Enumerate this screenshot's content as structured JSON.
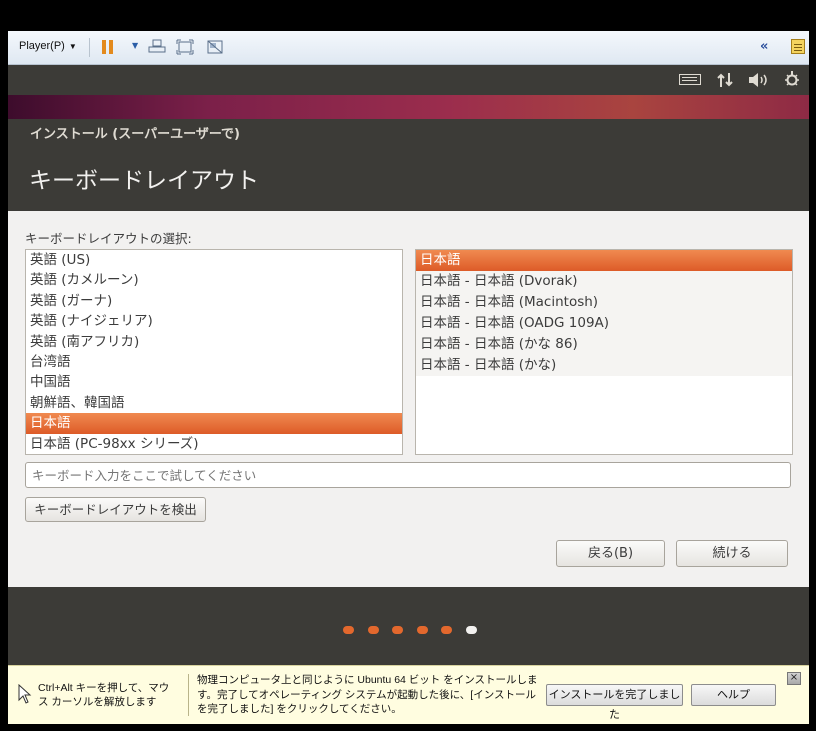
{
  "player": {
    "menu_label": "Player(P)",
    "caret": "▼",
    "pause_caret": "▼",
    "collapse": "«"
  },
  "panel": {
    "icons": [
      "keyboard-icon",
      "network-icon",
      "volume-icon",
      "settings-icon"
    ]
  },
  "window": {
    "title": "インストール (スーパーユーザーで)",
    "page_title": "キーボードレイアウト"
  },
  "layout": {
    "select_label": "キーボードレイアウトの選択:",
    "languages": [
      {
        "label": "英語 (US)",
        "selected": false
      },
      {
        "label": "英語 (カメルーン)",
        "selected": false
      },
      {
        "label": "英語 (ガーナ)",
        "selected": false
      },
      {
        "label": "英語 (ナイジェリア)",
        "selected": false
      },
      {
        "label": "英語 (南アフリカ)",
        "selected": false
      },
      {
        "label": "台湾語",
        "selected": false
      },
      {
        "label": "中国語",
        "selected": false
      },
      {
        "label": "朝鮮語、韓国語",
        "selected": false
      },
      {
        "label": "日本語",
        "selected": true
      },
      {
        "label": "日本語 (PC-98xx シリーズ)",
        "selected": false
      }
    ],
    "variants": [
      {
        "label": "日本語",
        "selected": true
      },
      {
        "label": "日本語 - 日本語 (Dvorak)",
        "selected": false
      },
      {
        "label": "日本語 - 日本語 (Macintosh)",
        "selected": false
      },
      {
        "label": "日本語 - 日本語 (OADG 109A)",
        "selected": false
      },
      {
        "label": "日本語 - 日本語 (かな 86)",
        "selected": false
      },
      {
        "label": "日本語 - 日本語 (かな)",
        "selected": false
      }
    ],
    "try_placeholder": "キーボード入力をここで試してください",
    "detect_label": "キーボードレイアウトを検出",
    "back_label": "戻る(B)",
    "continue_label": "続ける"
  },
  "progress": {
    "total_steps": 6,
    "current_step": 6
  },
  "hint": {
    "left_text": "Ctrl+Alt キーを押して、マウス カーソルを解放します",
    "main_text": "物理コンピュータ上と同じように Ubuntu 64 ビット をインストールします。完了してオペレーティング システムが起動した後に、[インストールを完了しました] をクリックしてください。",
    "finish_label": "インストールを完了しました",
    "help_label": "ヘルプ",
    "close": "×"
  },
  "colors": {
    "accent": "#dd4814",
    "panel": "#3c3b37",
    "content_bg": "#f2f1f0"
  }
}
